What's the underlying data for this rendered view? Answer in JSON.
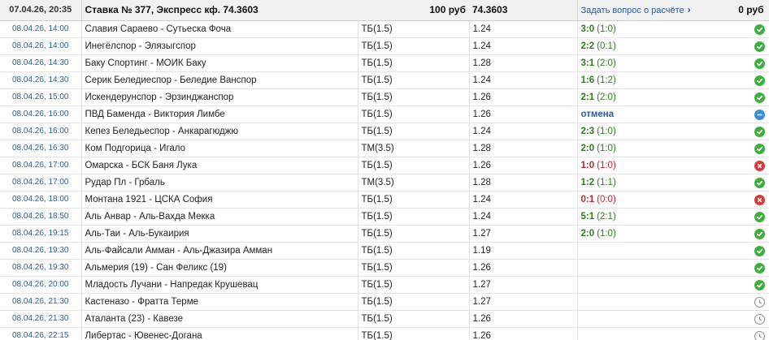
{
  "header": {
    "date": "07.04.26, 20:35",
    "title": "Ставка № 377, Экспресс кф. 74.3603",
    "stake": "100 руб",
    "total_coef": "74.3603",
    "ask_link": "Задать вопрос о расчёте",
    "payout": "0 руб"
  },
  "status_colors": {
    "win": "#3fae3f",
    "lose": "#d9383a",
    "void": "#3b8fd4",
    "pending": "#8c8c8c"
  },
  "rows": [
    {
      "date": "08.04.26, 14:00",
      "match": "Славия Сараево - Сутьеска Фоча",
      "bet": "ТБ(1.5)",
      "coef": "1.24",
      "score": "3:0",
      "half": "(1:0)",
      "status": "win"
    },
    {
      "date": "08.04.26, 14:00",
      "match": "Инегёлспор - Элязыгспор",
      "bet": "ТБ(1.5)",
      "coef": "1.24",
      "score": "2:2",
      "half": "(0:1)",
      "status": "win"
    },
    {
      "date": "08.04.26, 14:30",
      "match": "Баку Спортинг - МОИК Баку",
      "bet": "ТБ(1.5)",
      "coef": "1.28",
      "score": "3:1",
      "half": "(2:0)",
      "status": "win"
    },
    {
      "date": "08.04.26, 14:30",
      "match": "Серик Беледиеспор - Беледие Ванспор",
      "bet": "ТБ(1.5)",
      "coef": "1.24",
      "score": "1:6",
      "half": "(1:2)",
      "status": "win"
    },
    {
      "date": "08.04.26, 15:00",
      "match": "Искендерунспор - Эрзинджанспор",
      "bet": "ТБ(1.5)",
      "coef": "1.26",
      "score": "2:1",
      "half": "(2:0)",
      "status": "win"
    },
    {
      "date": "08.04.26, 16:00",
      "match": "ПВД Баменда - Виктория Лимбе",
      "bet": "ТБ(1.5)",
      "coef": "1.26",
      "score": "отмена",
      "half": "",
      "status": "void"
    },
    {
      "date": "08.04.26, 16:00",
      "match": "Кепез Беледьеспор - Анкарагюджю",
      "bet": "ТБ(1.5)",
      "coef": "1.24",
      "score": "2:3",
      "half": "(1:0)",
      "status": "win"
    },
    {
      "date": "08.04.26, 16:30",
      "match": "Ком Подгорица - Игало",
      "bet": "ТМ(3.5)",
      "coef": "1.28",
      "score": "2:0",
      "half": "(1:0)",
      "status": "win"
    },
    {
      "date": "08.04.26, 17:00",
      "match": "Омарска - БСК Баня Лука",
      "bet": "ТБ(1.5)",
      "coef": "1.26",
      "score": "1:0",
      "half": "(1:0)",
      "status": "lose"
    },
    {
      "date": "08.04.26, 17:00",
      "match": "Рудар Пл - Грбаль",
      "bet": "ТМ(3.5)",
      "coef": "1.28",
      "score": "1:2",
      "half": "(1:1)",
      "status": "win"
    },
    {
      "date": "08.04.26, 18:00",
      "match": "Монтана 1921 - ЦСКА София",
      "bet": "ТБ(1.5)",
      "coef": "1.24",
      "score": "0:1",
      "half": "(0:0)",
      "status": "lose"
    },
    {
      "date": "08.04.26, 18:50",
      "match": "Аль Анвар - Аль-Вахда Мекка",
      "bet": "ТБ(1.5)",
      "coef": "1.24",
      "score": "5:1",
      "half": "(2:1)",
      "status": "win"
    },
    {
      "date": "08.04.26, 19:15",
      "match": "Аль-Таи - Аль-Букаирия",
      "bet": "ТБ(1.5)",
      "coef": "1.27",
      "score": "2:0",
      "half": "(1:0)",
      "status": "win"
    },
    {
      "date": "08.04.26, 19:30",
      "match": "Аль-Файсали Амман - Аль-Джазира Амман",
      "bet": "ТБ(1.5)",
      "coef": "1.19",
      "score": "",
      "half": "",
      "status": "win"
    },
    {
      "date": "08.04.26, 19:30",
      "match": "Альмерия (19) - Сан Феликс (19)",
      "bet": "ТБ(1.5)",
      "coef": "1.26",
      "score": "",
      "half": "",
      "status": "win"
    },
    {
      "date": "08.04.26, 20:00",
      "match": "Младость Лучани - Напредак Крушевац",
      "bet": "ТБ(1.5)",
      "coef": "1.27",
      "score": "",
      "half": "",
      "status": "win"
    },
    {
      "date": "08.04.26, 21:30",
      "match": "Кастеназо - Фратта Терме",
      "bet": "ТБ(1.5)",
      "coef": "1.27",
      "score": "",
      "half": "",
      "status": "pending"
    },
    {
      "date": "08.04.26, 21:30",
      "match": "Аталанта (23) - Кавезе",
      "bet": "ТБ(1.5)",
      "coef": "1.26",
      "score": "",
      "half": "",
      "status": "pending"
    },
    {
      "date": "08.04.26, 22:15",
      "match": "Либертас - Ювенес-Догана",
      "bet": "ТБ(1.5)",
      "coef": "1.26",
      "score": "",
      "half": "",
      "status": "pending"
    }
  ]
}
